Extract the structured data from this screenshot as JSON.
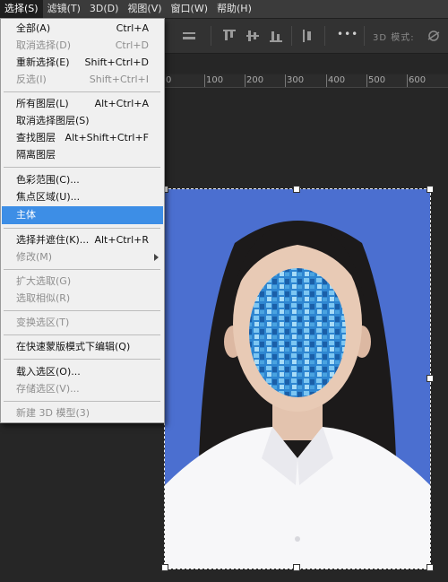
{
  "menubar": {
    "items": [
      "选择(S)",
      "滤镜(T)",
      "3D(D)",
      "视图(V)",
      "窗口(W)",
      "帮助(H)"
    ]
  },
  "optionsbar": {
    "mode_label": "3D 模式:",
    "more_label": "•••"
  },
  "ruler": {
    "labels": [
      "0",
      "100",
      "200",
      "300",
      "400",
      "500",
      "600"
    ]
  },
  "select_menu": {
    "items": [
      {
        "label": "全部(A)",
        "shortcut": "Ctrl+A",
        "disabled": false
      },
      {
        "label": "取消选择(D)",
        "shortcut": "Ctrl+D",
        "disabled": true
      },
      {
        "label": "重新选择(E)",
        "shortcut": "Shift+Ctrl+D",
        "disabled": false
      },
      {
        "label": "反选(I)",
        "shortcut": "Shift+Ctrl+I",
        "disabled": true
      },
      {
        "label": "所有图层(L)",
        "shortcut": "Alt+Ctrl+A",
        "disabled": false
      },
      {
        "label": "取消选择图层(S)",
        "shortcut": "",
        "disabled": false
      },
      {
        "label": "查找图层",
        "shortcut": "Alt+Shift+Ctrl+F",
        "disabled": false
      },
      {
        "label": "隔离图层",
        "shortcut": "",
        "disabled": false
      },
      {
        "label": "色彩范围(C)...",
        "shortcut": "",
        "disabled": false
      },
      {
        "label": "焦点区域(U)...",
        "shortcut": "",
        "disabled": false
      },
      {
        "label": "主体",
        "shortcut": "",
        "disabled": false,
        "highlighted": true
      },
      {
        "label": "选择并遮住(K)...",
        "shortcut": "Alt+Ctrl+R",
        "disabled": false
      },
      {
        "label": "修改(M)",
        "shortcut": "",
        "disabled": true,
        "submenu": true
      },
      {
        "label": "扩大选取(G)",
        "shortcut": "",
        "disabled": true
      },
      {
        "label": "选取相似(R)",
        "shortcut": "",
        "disabled": true
      },
      {
        "label": "变换选区(T)",
        "shortcut": "",
        "disabled": true
      },
      {
        "label": "在快速蒙版模式下编辑(Q)",
        "shortcut": "",
        "disabled": false
      },
      {
        "label": "载入选区(O)...",
        "shortcut": "",
        "disabled": false
      },
      {
        "label": "存储选区(V)...",
        "shortcut": "",
        "disabled": true
      },
      {
        "label": "新建 3D 模型(3)",
        "shortcut": "",
        "disabled": true
      }
    ]
  },
  "colors": {
    "highlight": "#3d8ee6",
    "photo_background": "#4b6fd0",
    "mosaic": "#2f8fd6"
  }
}
